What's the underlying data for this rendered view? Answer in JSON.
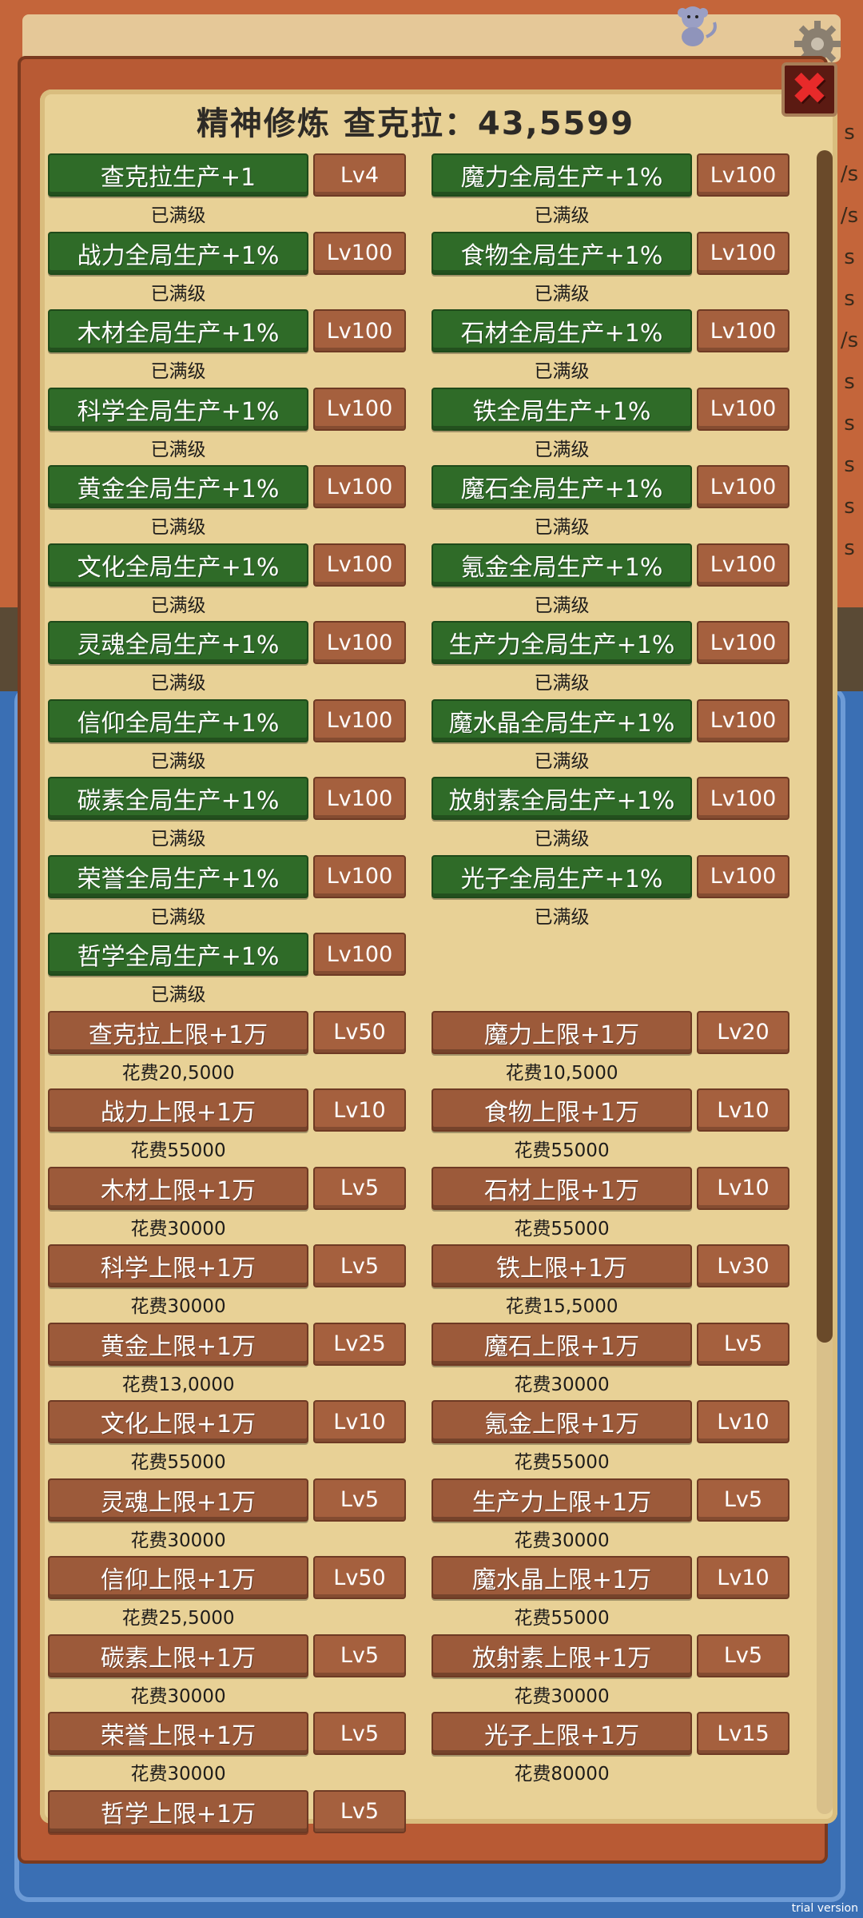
{
  "title": "精神修炼  查克拉：43,5599",
  "trial_text": "trial version",
  "close_icon": "✖",
  "bg_letters": [
    "s",
    "/s",
    "/s",
    "s",
    "s",
    "/s",
    "s",
    "s",
    "s",
    "s",
    "s"
  ],
  "items": [
    {
      "name": "查克拉生产+1",
      "level": "Lv4",
      "status": "已满级",
      "style": "green"
    },
    {
      "name": "魔力全局生产+1%",
      "level": "Lv100",
      "status": "已满级",
      "style": "green"
    },
    {
      "name": "战力全局生产+1%",
      "level": "Lv100",
      "status": "已满级",
      "style": "green"
    },
    {
      "name": "食物全局生产+1%",
      "level": "Lv100",
      "status": "已满级",
      "style": "green"
    },
    {
      "name": "木材全局生产+1%",
      "level": "Lv100",
      "status": "已满级",
      "style": "green"
    },
    {
      "name": "石材全局生产+1%",
      "level": "Lv100",
      "status": "已满级",
      "style": "green"
    },
    {
      "name": "科学全局生产+1%",
      "level": "Lv100",
      "status": "已满级",
      "style": "green"
    },
    {
      "name": "铁全局生产+1%",
      "level": "Lv100",
      "status": "已满级",
      "style": "green"
    },
    {
      "name": "黄金全局生产+1%",
      "level": "Lv100",
      "status": "已满级",
      "style": "green"
    },
    {
      "name": "魔石全局生产+1%",
      "level": "Lv100",
      "status": "已满级",
      "style": "green"
    },
    {
      "name": "文化全局生产+1%",
      "level": "Lv100",
      "status": "已满级",
      "style": "green"
    },
    {
      "name": "氪金全局生产+1%",
      "level": "Lv100",
      "status": "已满级",
      "style": "green"
    },
    {
      "name": "灵魂全局生产+1%",
      "level": "Lv100",
      "status": "已满级",
      "style": "green"
    },
    {
      "name": "生产力全局生产+1%",
      "level": "Lv100",
      "status": "已满级",
      "style": "green"
    },
    {
      "name": "信仰全局生产+1%",
      "level": "Lv100",
      "status": "已满级",
      "style": "green"
    },
    {
      "name": "魔水晶全局生产+1%",
      "level": "Lv100",
      "status": "已满级",
      "style": "green"
    },
    {
      "name": "碳素全局生产+1%",
      "level": "Lv100",
      "status": "已满级",
      "style": "green"
    },
    {
      "name": "放射素全局生产+1%",
      "level": "Lv100",
      "status": "已满级",
      "style": "green"
    },
    {
      "name": "荣誉全局生产+1%",
      "level": "Lv100",
      "status": "已满级",
      "style": "green"
    },
    {
      "name": "光子全局生产+1%",
      "level": "Lv100",
      "status": "已满级",
      "style": "green"
    },
    {
      "name": "哲学全局生产+1%",
      "level": "Lv100",
      "status": "已满级",
      "style": "green"
    },
    null,
    {
      "name": "查克拉上限+1万",
      "level": "Lv50",
      "status": "花费20,5000",
      "style": "brown"
    },
    {
      "name": "魔力上限+1万",
      "level": "Lv20",
      "status": "花费10,5000",
      "style": "brown"
    },
    {
      "name": "战力上限+1万",
      "level": "Lv10",
      "status": "花费55000",
      "style": "brown"
    },
    {
      "name": "食物上限+1万",
      "level": "Lv10",
      "status": "花费55000",
      "style": "brown"
    },
    {
      "name": "木材上限+1万",
      "level": "Lv5",
      "status": "花费30000",
      "style": "brown"
    },
    {
      "name": "石材上限+1万",
      "level": "Lv10",
      "status": "花费55000",
      "style": "brown"
    },
    {
      "name": "科学上限+1万",
      "level": "Lv5",
      "status": "花费30000",
      "style": "brown"
    },
    {
      "name": "铁上限+1万",
      "level": "Lv30",
      "status": "花费15,5000",
      "style": "brown"
    },
    {
      "name": "黄金上限+1万",
      "level": "Lv25",
      "status": "花费13,0000",
      "style": "brown"
    },
    {
      "name": "魔石上限+1万",
      "level": "Lv5",
      "status": "花费30000",
      "style": "brown"
    },
    {
      "name": "文化上限+1万",
      "level": "Lv10",
      "status": "花费55000",
      "style": "brown"
    },
    {
      "name": "氪金上限+1万",
      "level": "Lv10",
      "status": "花费55000",
      "style": "brown"
    },
    {
      "name": "灵魂上限+1万",
      "level": "Lv5",
      "status": "花费30000",
      "style": "brown"
    },
    {
      "name": "生产力上限+1万",
      "level": "Lv5",
      "status": "花费30000",
      "style": "brown"
    },
    {
      "name": "信仰上限+1万",
      "level": "Lv50",
      "status": "花费25,5000",
      "style": "brown"
    },
    {
      "name": "魔水晶上限+1万",
      "level": "Lv10",
      "status": "花费55000",
      "style": "brown"
    },
    {
      "name": "碳素上限+1万",
      "level": "Lv5",
      "status": "花费30000",
      "style": "brown"
    },
    {
      "name": "放射素上限+1万",
      "level": "Lv5",
      "status": "花费30000",
      "style": "brown"
    },
    {
      "name": "荣誉上限+1万",
      "level": "Lv5",
      "status": "花费30000",
      "style": "brown"
    },
    {
      "name": "光子上限+1万",
      "level": "Lv15",
      "status": "花费80000",
      "style": "brown"
    },
    {
      "name": "哲学上限+1万",
      "level": "Lv5",
      "status": "",
      "style": "brown"
    }
  ]
}
